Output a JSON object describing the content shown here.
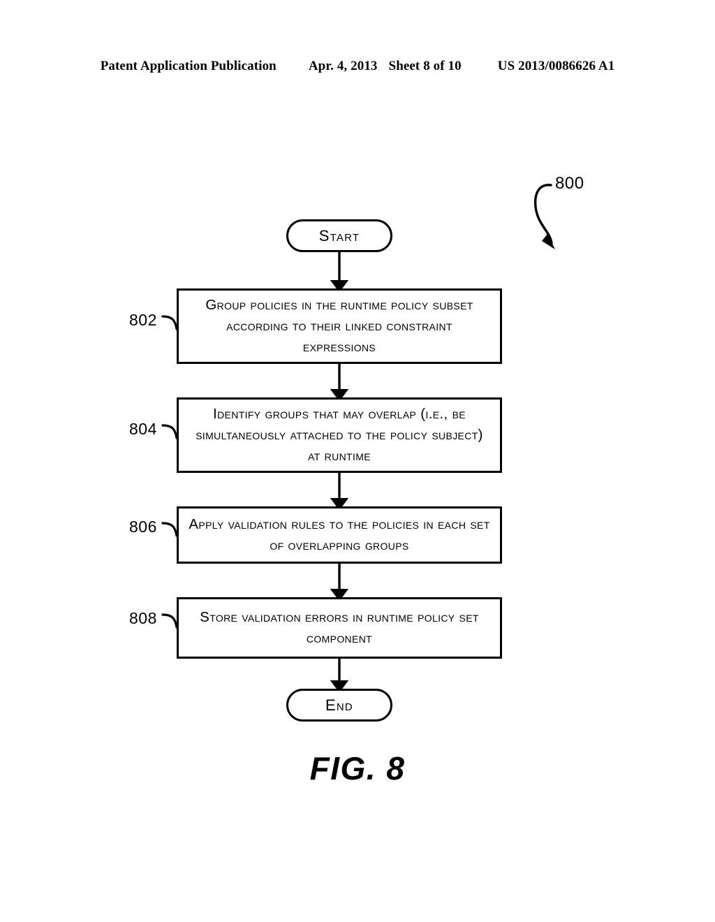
{
  "page": {
    "background_color": "#ffffff",
    "ink_color": "#000000"
  },
  "header": {
    "publication": "Patent Application Publication",
    "date": "Apr. 4, 2013",
    "sheet": "Sheet 8 of 10",
    "patent_number": "US 2013/0086626 A1"
  },
  "figure": {
    "caption": "FIG. 8",
    "reference_numeral": "800"
  },
  "flowchart": {
    "type": "flowchart",
    "orientation": "vertical-top-to-bottom",
    "start": {
      "label": "Start",
      "shape": "terminator-capsule"
    },
    "end": {
      "label": "End",
      "shape": "terminator-capsule"
    },
    "steps": [
      {
        "ref": "802",
        "shape": "process-rectangle",
        "text": "Group policies in the runtime policy subset according to their linked constraint expressions"
      },
      {
        "ref": "804",
        "shape": "process-rectangle",
        "text": "Identify groups that may overlap (i.e., be simultaneously attached to the policy subject) at runtime"
      },
      {
        "ref": "806",
        "shape": "process-rectangle",
        "text": "Apply validation rules to the policies in each set of overlapping groups"
      },
      {
        "ref": "808",
        "shape": "process-rectangle",
        "text": "Store validation errors in runtime policy set component"
      }
    ],
    "connectors": [
      {
        "from": "start",
        "to": "802",
        "style": "solid-arrow-down"
      },
      {
        "from": "802",
        "to": "804",
        "style": "solid-arrow-down"
      },
      {
        "from": "804",
        "to": "806",
        "style": "solid-arrow-down"
      },
      {
        "from": "806",
        "to": "808",
        "style": "solid-arrow-down"
      },
      {
        "from": "808",
        "to": "end",
        "style": "solid-arrow-down"
      }
    ],
    "lead_lines": [
      {
        "ref": "802",
        "style": "curved-leader"
      },
      {
        "ref": "804",
        "style": "curved-leader"
      },
      {
        "ref": "806",
        "style": "curved-leader"
      },
      {
        "ref": "808",
        "style": "curved-leader"
      },
      {
        "ref": "800",
        "style": "s-curve-arrow"
      }
    ]
  }
}
